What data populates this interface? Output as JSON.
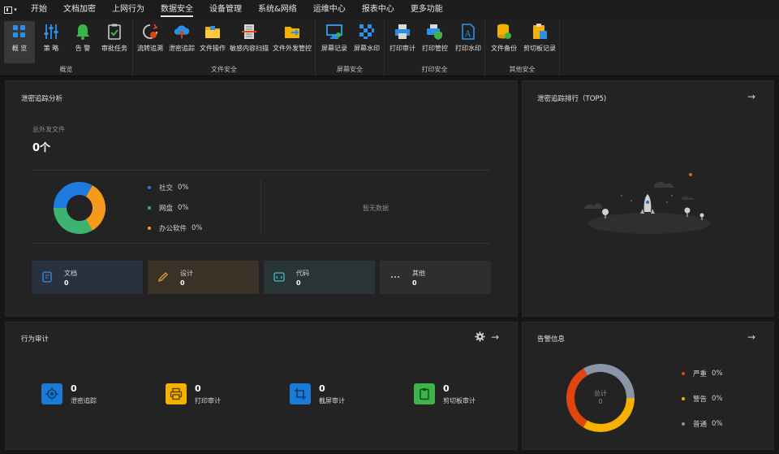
{
  "menu": {
    "items": [
      "开始",
      "文档加密",
      "上网行为",
      "数据安全",
      "设备管理",
      "系统&网络",
      "运维中心",
      "报表中心",
      "更多功能"
    ],
    "active": "数据安全"
  },
  "ribbon": {
    "groups": [
      {
        "label": "概览",
        "buttons": [
          "概 览",
          "策 略",
          "告 警",
          "审批任务"
        ]
      },
      {
        "label": "文件安全",
        "buttons": [
          "流转追溯",
          "泄密追踪",
          "文件操作",
          "敏感内容扫描",
          "文件外发管控"
        ]
      },
      {
        "label": "屏幕安全",
        "buttons": [
          "屏幕记录",
          "屏幕水印"
        ]
      },
      {
        "label": "打印安全",
        "buttons": [
          "打印审计",
          "打印管控",
          "打印水印"
        ]
      },
      {
        "label": "其他安全",
        "buttons": [
          "文件备份",
          "剪切板记录"
        ]
      }
    ]
  },
  "leak_analysis": {
    "title": "泄密追踪分析",
    "total_label": "总外发文件",
    "total_value": "0个",
    "legend": [
      {
        "label": "社交",
        "value": "0%",
        "color": "#1e7be0"
      },
      {
        "label": "网盘",
        "value": "0%",
        "color": "#3cb371"
      },
      {
        "label": "办公软件",
        "value": "0%",
        "color": "#f59a1a"
      }
    ],
    "no_data": "暂无数据",
    "categories": [
      {
        "name": "文档",
        "value": "0",
        "icon": "document-icon",
        "color": "#3a8ee6",
        "bg": "#28313d"
      },
      {
        "name": "设计",
        "value": "0",
        "icon": "pencil-icon",
        "color": "#e0a040",
        "bg": "#3a3226"
      },
      {
        "name": "代码",
        "value": "0",
        "icon": "code-icon",
        "color": "#3cc0c0",
        "bg": "#283436"
      },
      {
        "name": "其他",
        "value": "0",
        "icon": "more-icon",
        "color": "#cccccc",
        "bg": "#2e2e2e"
      }
    ]
  },
  "top5": {
    "title": "泄密追踪排行（TOP5)"
  },
  "behavior_audit": {
    "title": "行为审计",
    "items": [
      {
        "value": "0",
        "name": "泄密追踪",
        "icon": "target-icon",
        "color": "#1a7ad8"
      },
      {
        "value": "0",
        "name": "打印审计",
        "icon": "printer-icon",
        "color": "#f5b000"
      },
      {
        "value": "0",
        "name": "截屏审计",
        "icon": "crop-icon",
        "color": "#1a7ad8"
      },
      {
        "value": "0",
        "name": "剪切板审计",
        "icon": "clipboard-icon",
        "color": "#3cb44a"
      }
    ]
  },
  "alerts": {
    "title": "告警信息",
    "center_label": "总计",
    "center_value": "0",
    "legend": [
      {
        "label": "严重",
        "value": "0%",
        "color": "#e0450f"
      },
      {
        "label": "警告",
        "value": "0%",
        "color": "#f5b000"
      },
      {
        "label": "普通",
        "value": "0%",
        "color": "#8a95a8"
      }
    ]
  }
}
